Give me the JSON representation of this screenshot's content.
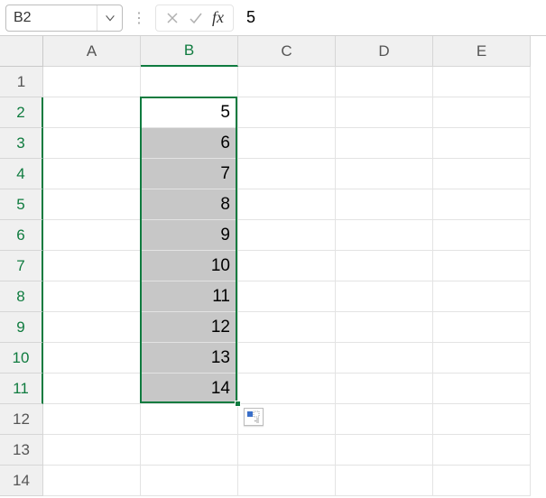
{
  "namebox": {
    "value": "B2"
  },
  "formula_bar": {
    "fx_label": "fx",
    "value": "5"
  },
  "columns": [
    "A",
    "B",
    "C",
    "D",
    "E"
  ],
  "rows": [
    "1",
    "2",
    "3",
    "4",
    "5",
    "6",
    "7",
    "8",
    "9",
    "10",
    "11",
    "12",
    "13",
    "14"
  ],
  "active_column": "B",
  "active_rows_start": 2,
  "active_rows_end": 11,
  "selection": {
    "col": "B",
    "row_start": 2,
    "row_end": 11,
    "active_cell": "B2"
  },
  "cells": {
    "B2": "5",
    "B3": "6",
    "B4": "7",
    "B5": "8",
    "B6": "9",
    "B7": "10",
    "B8": "11",
    "B9": "12",
    "B10": "13",
    "B11": "14"
  },
  "chart_data": {
    "type": "table",
    "title": "",
    "columns": [
      "B"
    ],
    "rows": [
      {
        "row": 2,
        "B": 5
      },
      {
        "row": 3,
        "B": 6
      },
      {
        "row": 4,
        "B": 7
      },
      {
        "row": 5,
        "B": 8
      },
      {
        "row": 6,
        "B": 9
      },
      {
        "row": 7,
        "B": 10
      },
      {
        "row": 8,
        "B": 11
      },
      {
        "row": 9,
        "B": 12
      },
      {
        "row": 10,
        "B": 13
      },
      {
        "row": 11,
        "B": 14
      }
    ]
  },
  "colors": {
    "selection": "#0f7b3f",
    "fill_bg": "#c7c7c7"
  }
}
